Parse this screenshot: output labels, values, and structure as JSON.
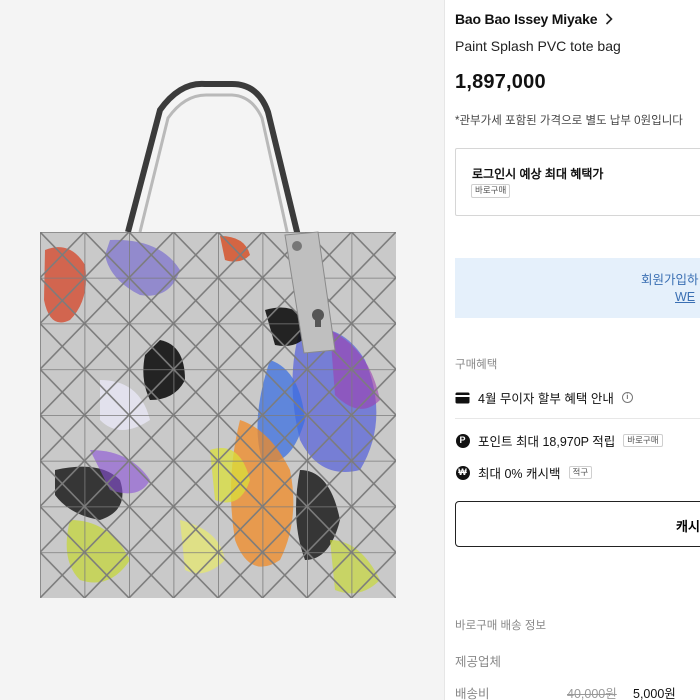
{
  "product": {
    "brand": "Bao Bao Issey Miyake",
    "name": "Paint Splash PVC tote bag",
    "price": "1,897,000",
    "tax_note": "*관부가세 포함된 가격으로 별도 납부 0원입니다"
  },
  "login_benefit": {
    "title": "로그인시 예상 최대 혜택가",
    "tag": "바로구매"
  },
  "join_banner": {
    "text": "회원가입하",
    "link": "WE"
  },
  "benefits": {
    "title": "구매혜택",
    "items": [
      {
        "icon": "card-icon",
        "label": "4월 무이자 할부 혜택 안내",
        "extra": "i"
      },
      {
        "icon": "point-icon",
        "label": "포인트 최대 18,970P 적립",
        "tag": "바로구매"
      },
      {
        "icon": "won-icon",
        "label": "최대 0% 캐시백",
        "tag": "적구"
      }
    ],
    "icon_glyphs": {
      "point": "P",
      "won": "₩"
    }
  },
  "cash_button": {
    "label": "캐시"
  },
  "shipping": {
    "title": "바로구매 배송 정보",
    "provider_label": "제공업체",
    "fee_label": "배송비",
    "fee_original": "40,000원",
    "fee_sale": "5,000원"
  },
  "colors": {
    "accent_blue": "#3a6fb3",
    "banner_bg": "#e5f0fb",
    "text_primary": "#111111",
    "text_muted": "#888888"
  }
}
